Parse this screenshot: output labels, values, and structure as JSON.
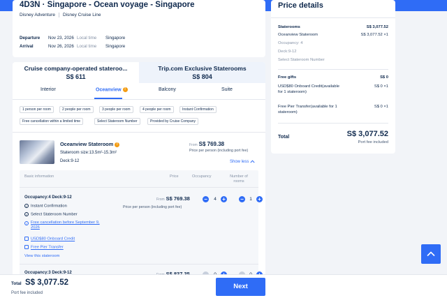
{
  "colors": {
    "primary": "#2f6cf6",
    "text": "#0f294d",
    "muted": "#8592a6",
    "info": "#f39c12",
    "background": "#f2f4f8"
  },
  "voyage": {
    "title": "4D3N · Singapore - Ocean voyage - Singapore",
    "brand": "Disney Adventure",
    "line": "Disney Cruise Line",
    "departure": {
      "label": "Departure",
      "date": "Nov 23, 2026",
      "tz": "Local time",
      "port": "Singapore"
    },
    "arrival": {
      "label": "Arrival",
      "date": "Nov 26, 2026",
      "tz": "Local time",
      "port": "Singapore"
    }
  },
  "source_tabs": [
    {
      "label": "Cruise company-operated stateroo...",
      "price": "S$ 611"
    },
    {
      "label": "Trip.com Exclusive Staterooms",
      "price": "S$ 804"
    }
  ],
  "cabin_tabs": [
    "Interior",
    "Oceanview",
    "Balcony",
    "Suite"
  ],
  "filters": [
    "1 person per room",
    "2 people per room",
    "3 people per room",
    "4 people per room",
    "Instant Confirmation",
    "Free cancellation within a limited time",
    "Select Stateroom Number",
    "Provided by Cruise Company"
  ],
  "room": {
    "name": "Oceanview Stateroom",
    "size": "Stateroom size:13.5m²-15.3m²",
    "deck": "Deck:9-12",
    "from": "From",
    "price": "S$ 769.38",
    "price_note": "Price per person (including port fee)",
    "show_less": "Show less"
  },
  "options_table": {
    "headers": {
      "basic": "Basic information",
      "price": "Price",
      "occupancy": "Occupancy",
      "rooms": "Number of rooms"
    },
    "options": [
      {
        "title": "Occupancy:4    Deck:9-12",
        "instant": "Instant Confirmation",
        "select_number": "Select Stateroom Number",
        "cancellation": "Free cancellation before September 9, 2026",
        "credit": "USD$80 Onboard Credit",
        "transfer": "Free Pier Transfer",
        "view": "View this stateroom",
        "from": "From",
        "price": "S$ 769.38",
        "note": "Price per person (including port fee)",
        "occupancy": "4",
        "rooms": "1"
      },
      {
        "title": "Occupancy:3    Deck:9-12",
        "from": "From",
        "price": "S$ 837.35",
        "occupancy": "0",
        "rooms": "0"
      }
    ]
  },
  "price_details": {
    "title": "Price details",
    "staterooms": {
      "label": "Staterooms",
      "amount": "S$ 3,077.52"
    },
    "room_line": {
      "label": "Oceanview Stateroom",
      "amount": "S$ 3,077.52 ×1"
    },
    "occupancy": "Occupancy: 4",
    "deck": "Deck:9-12",
    "select_number": "Select Stateroom Number",
    "gifts": {
      "label": "Free gifts",
      "amount": "S$ 0"
    },
    "gift1": {
      "label": "USD$80 Onboard Credit(available for 1 stateroom)",
      "amount": "S$ 0 ×1"
    },
    "gift2": {
      "label": "Free Pier Transfer(available for 1 stateroom)",
      "amount": "S$ 0 ×1"
    },
    "total_label": "Total",
    "total": "S$ 3,077.52",
    "port_fee": "Port fee included"
  },
  "bottom": {
    "total_label": "Total",
    "total": "S$ 3,077.52",
    "port_fee": "Port fee included",
    "next": "Next"
  },
  "icons": {
    "info": "info-icon",
    "check": "check-circle-icon",
    "gift": "gift-icon",
    "chevron": "chevron-up-icon",
    "arrow": "arrow-up-icon"
  }
}
